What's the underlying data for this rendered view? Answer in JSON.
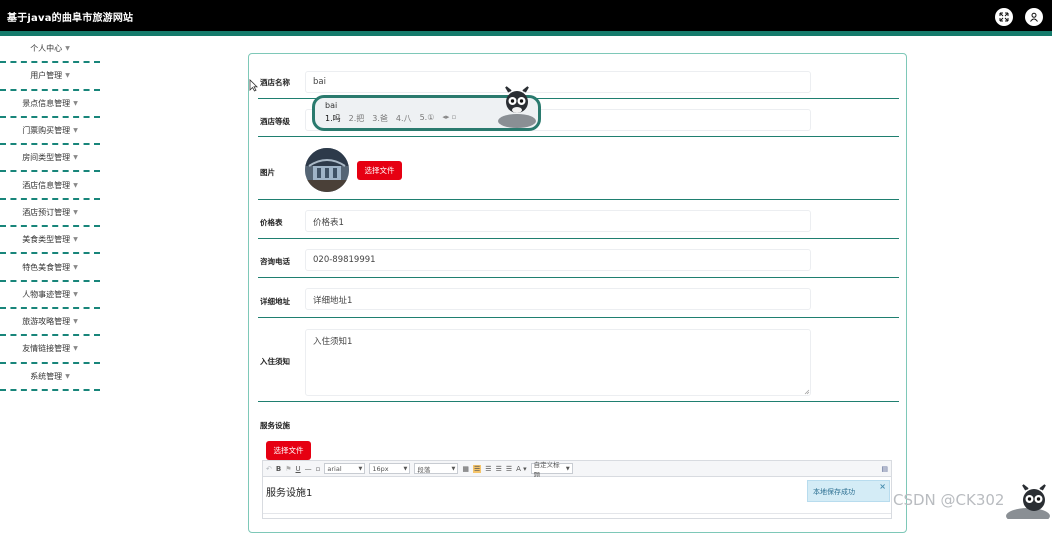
{
  "app": {
    "title": "基于java的曲阜市旅游网站"
  },
  "header_icons": {
    "fullscreen": "expand-icon",
    "user": "user-icon"
  },
  "sidebar": {
    "items": [
      {
        "label": "个人中心"
      },
      {
        "label": "用户管理"
      },
      {
        "label": "景点信息管理"
      },
      {
        "label": "门票购买管理"
      },
      {
        "label": "房间类型管理"
      },
      {
        "label": "酒店信息管理"
      },
      {
        "label": "酒店预订管理"
      },
      {
        "label": "美食类型管理"
      },
      {
        "label": "特色美食管理"
      },
      {
        "label": "人物事迹管理"
      },
      {
        "label": "旅游攻略管理"
      },
      {
        "label": "友情链接管理"
      },
      {
        "label": "系统管理"
      }
    ]
  },
  "form": {
    "hotel_name": {
      "label": "酒店名称",
      "value": "bai"
    },
    "hotel_level": {
      "label": "酒店等级",
      "value": ""
    },
    "image": {
      "label": "图片",
      "button": "选择文件"
    },
    "price_list": {
      "label": "价格表",
      "value": "价格表1"
    },
    "phone": {
      "label": "咨询电话",
      "value": "020-89819991"
    },
    "address": {
      "label": "详细地址",
      "value": "详细地址1"
    },
    "notice": {
      "label": "入住须知",
      "value": "入住须知1"
    },
    "facilities": {
      "label": "服务设施",
      "button": "选择文件",
      "content": "服务设施1"
    }
  },
  "ime": {
    "input": "bai",
    "candidates": [
      "1.吗",
      "2.把",
      "3.爸",
      "4.八",
      "5.①"
    ]
  },
  "editor_toolbar": {
    "font": "arial",
    "size": "16px",
    "style": "段落",
    "custom": "自定义标题",
    "color_letter": "A"
  },
  "toast": {
    "text": "本地保存成功",
    "close": "×"
  },
  "watermark": "CSDN @CK302"
}
